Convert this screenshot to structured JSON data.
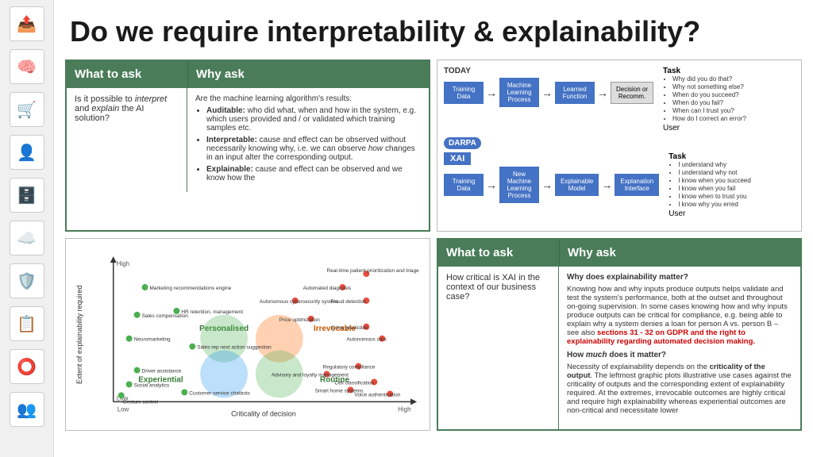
{
  "sidebar": {
    "icons": [
      {
        "name": "share-icon",
        "symbol": "📤"
      },
      {
        "name": "brain-icon",
        "symbol": "🧠"
      },
      {
        "name": "cart-icon",
        "symbol": "🛒"
      },
      {
        "name": "person-icon",
        "symbol": "👤"
      },
      {
        "name": "database-icon",
        "symbol": "🗄️"
      },
      {
        "name": "cloud-icon",
        "symbol": "☁️"
      },
      {
        "name": "shield-icon",
        "symbol": "🛡️"
      },
      {
        "name": "clipboard-icon",
        "symbol": "📋"
      },
      {
        "name": "circle-icon",
        "symbol": "⭕"
      },
      {
        "name": "group-icon",
        "symbol": "👥"
      }
    ]
  },
  "page": {
    "title": "Do we require interpretability & explainability?"
  },
  "top_left": {
    "header_what": "What to ask",
    "header_why": "Why ask",
    "body_what": "Is it possible to interpret and explain the AI solution?",
    "body_why_intro": "Are the machine learning algorithm's results:",
    "body_why_bullets": [
      {
        "term": "Auditable:",
        "text": " who did what, when and how in the system, e.g. which users provided and / or validated which training samples etc."
      },
      {
        "term": "Interpretable:",
        "text": " cause and effect can be observed without necessarily knowing why, i.e. we can observe how changes in an input alter the corresponding output."
      },
      {
        "term": "Explainable:",
        "text": " cause and effect can be observed and we know how the"
      }
    ]
  },
  "top_right": {
    "today_label": "TODAY",
    "xai_label": "XAI",
    "darpa_label": "DARPA",
    "task_label": "Task",
    "user_label": "User",
    "today_flow": [
      "Training Data",
      "Machine Learning Process",
      "Learned Function",
      "Decision or Recommendation"
    ],
    "today_bullets": [
      "Why did you do that?",
      "Why not something else?",
      "When do you succeed?",
      "When do you fail?",
      "When can I trust you?",
      "How do I correct an error?"
    ],
    "xai_flow": [
      "Training Data",
      "New Machine Learning Process",
      "Explainable Model",
      "Explanation Interface"
    ],
    "xai_bullets": [
      "I understand why",
      "I understand why not",
      "I know when you succeed",
      "I know when you fail",
      "I know when to trust you",
      "I know why you erred"
    ]
  },
  "chart": {
    "x_label": "Criticality of decision",
    "y_label": "Extent of explainability required",
    "high_label": "High",
    "low_label": "Low",
    "labels": [
      "Marketing recommendations engine",
      "Sales compensation",
      "HR retention, management",
      "Neuromarketing",
      "Sales rep next action suggestion",
      "Driver assistance",
      "Social analytics",
      "Customer service chatbots",
      "Gesture control",
      "Real-time patient prioritization and triage",
      "Automated diagnosis",
      "Autonomous cybersecurity system",
      "Fraud detection",
      "Price optimization",
      "Crime prediction",
      "Autonomous cars",
      "Regulatory compliance",
      "Advisory and loyalty management",
      "Cell classification",
      "Smart home systems",
      "Voice authentication"
    ],
    "quadrants": [
      "Experiential",
      "Personalised",
      "Irrevocable",
      "Routine"
    ]
  },
  "bottom_right": {
    "header_what": "What to ask",
    "header_why": "Why ask",
    "body_what": "How critical is XAI in the context of our business case?",
    "section1_title": "Why does explainability matter?",
    "section1_text": "Knowing how and why inputs produce outputs helps validate and test the system's performance, both at the outset and throughout on-going supervision. In some cases knowing how and why inputs produce outputs can be critical for compliance, e.g. being able to explain why a system denies a loan for person A vs. person B – see also",
    "section1_highlight": "sections 31 - 32 on GDPR and the right to explainability regarding automated decision making.",
    "section2_title": "How much does it matter?",
    "section2_text": "Necessity of explainability depends on the",
    "section2_highlight": "criticality of the output",
    "section2_text2": ". The leftmost graphic plots illustrative use cases against the criticality of outputs and the corresponding extent of explainability required. At the extremes, irrevocable outcomes are highly critical and require high explainability whereas experiential outcomes are non-critical and necessitate lower"
  }
}
